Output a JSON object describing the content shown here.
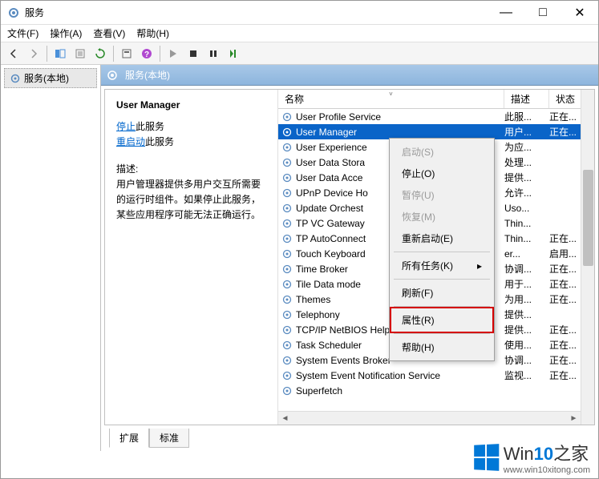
{
  "window": {
    "title": "服务",
    "btn_min": "—",
    "btn_max": "□",
    "btn_close": "✕"
  },
  "menu": {
    "file": "文件(F)",
    "action": "操作(A)",
    "view": "查看(V)",
    "help": "帮助(H)"
  },
  "tree": {
    "root": "服务(本地)"
  },
  "right_header": "服务(本地)",
  "detail": {
    "service_name": "User Manager",
    "stop_link": "停止",
    "stop_suffix": "此服务",
    "restart_link": "重启动",
    "restart_suffix": "此服务",
    "desc_label": "描述:",
    "description": "用户管理器提供多用户交互所需要的运行时组件。如果停止此服务，某些应用程序可能无法正确运行。"
  },
  "columns": {
    "name": "名称",
    "desc": "描述",
    "status": "状态"
  },
  "services": [
    {
      "name": "User Profile Service",
      "desc": "此服...",
      "status": "正在..."
    },
    {
      "name": "User Manager",
      "desc": "用户...",
      "status": "正在...",
      "selected": true
    },
    {
      "name": "User Experience",
      "desc": "为应...",
      "status": ""
    },
    {
      "name": "User Data Stora",
      "desc": "处理...",
      "status": ""
    },
    {
      "name": "User Data Acce",
      "desc": "提供...",
      "status": ""
    },
    {
      "name": "UPnP Device Ho",
      "desc": "允许...",
      "status": ""
    },
    {
      "name": "Update Orchest",
      "desc": "Uso...",
      "status": ""
    },
    {
      "name": "TP VC Gateway",
      "desc": "Thin...",
      "status": ""
    },
    {
      "name": "TP AutoConnect",
      "desc": "Thin...",
      "status": "正在..."
    },
    {
      "name": "Touch Keyboard",
      "desc": "er...",
      "status": "启用..."
    },
    {
      "name": "Time Broker",
      "desc": "协调...",
      "status": "正在..."
    },
    {
      "name": "Tile Data mode",
      "desc": "用于...",
      "status": "正在..."
    },
    {
      "name": "Themes",
      "desc": "为用...",
      "status": "正在..."
    },
    {
      "name": "Telephony",
      "desc": "提供...",
      "status": ""
    },
    {
      "name": "TCP/IP NetBIOS Helper",
      "desc": "提供...",
      "status": "正在..."
    },
    {
      "name": "Task Scheduler",
      "desc": "使用...",
      "status": "正在..."
    },
    {
      "name": "System Events Broker",
      "desc": "协调...",
      "status": "正在..."
    },
    {
      "name": "System Event Notification Service",
      "desc": "监视...",
      "status": "正在..."
    },
    {
      "name": "Superfetch",
      "desc": "",
      "status": ""
    }
  ],
  "context_menu": {
    "start": "启动(S)",
    "stop": "停止(O)",
    "pause": "暂停(U)",
    "resume": "恢复(M)",
    "restart": "重新启动(E)",
    "all_tasks": "所有任务(K)",
    "refresh": "刷新(F)",
    "properties": "属性(R)",
    "help": "帮助(H)"
  },
  "tabs": {
    "extended": "扩展",
    "standard": "标准"
  },
  "watermark": {
    "brand_a": "Win",
    "brand_b": "10",
    "brand_c": "之家",
    "url": "www.win10xitong.com"
  }
}
